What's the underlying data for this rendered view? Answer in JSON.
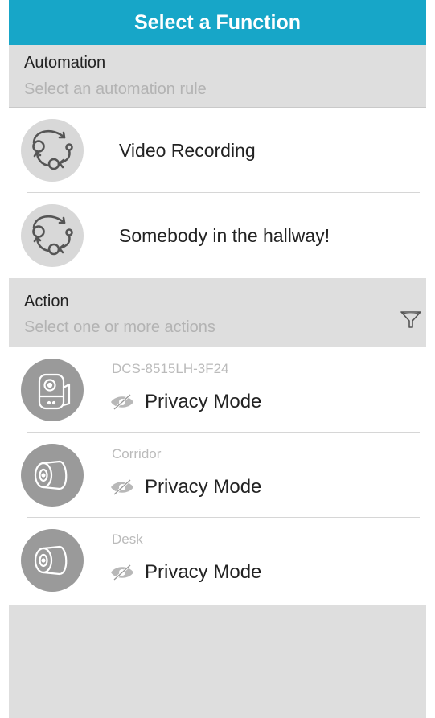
{
  "header": {
    "title": "Select a Function"
  },
  "automation": {
    "title": "Automation",
    "subtitle": "Select an automation rule",
    "items": [
      {
        "label": "Video Recording",
        "icon": "automation-cycle-icon"
      },
      {
        "label": "Somebody in the hallway!",
        "icon": "automation-cycle-icon"
      }
    ]
  },
  "action": {
    "title": "Action",
    "subtitle": "Select one or more actions",
    "filter_icon": "filter-icon",
    "items": [
      {
        "device": "DCS-8515LH-3F24",
        "action": "Privacy Mode",
        "device_icon": "pan-tilt-camera-icon",
        "action_icon": "eye-off-icon"
      },
      {
        "device": "Corridor",
        "action": "Privacy Mode",
        "device_icon": "mini-camera-icon",
        "action_icon": "eye-off-icon"
      },
      {
        "device": "Desk",
        "action": "Privacy Mode",
        "device_icon": "mini-camera-icon",
        "action_icon": "eye-off-icon"
      }
    ]
  },
  "colors": {
    "header_bg": "#17a6c8",
    "section_bg": "#dedede",
    "icon_light_bg": "#d8d8d8",
    "icon_dark_bg": "#9a9a9a",
    "subtitle_text": "#b3b3b3"
  }
}
